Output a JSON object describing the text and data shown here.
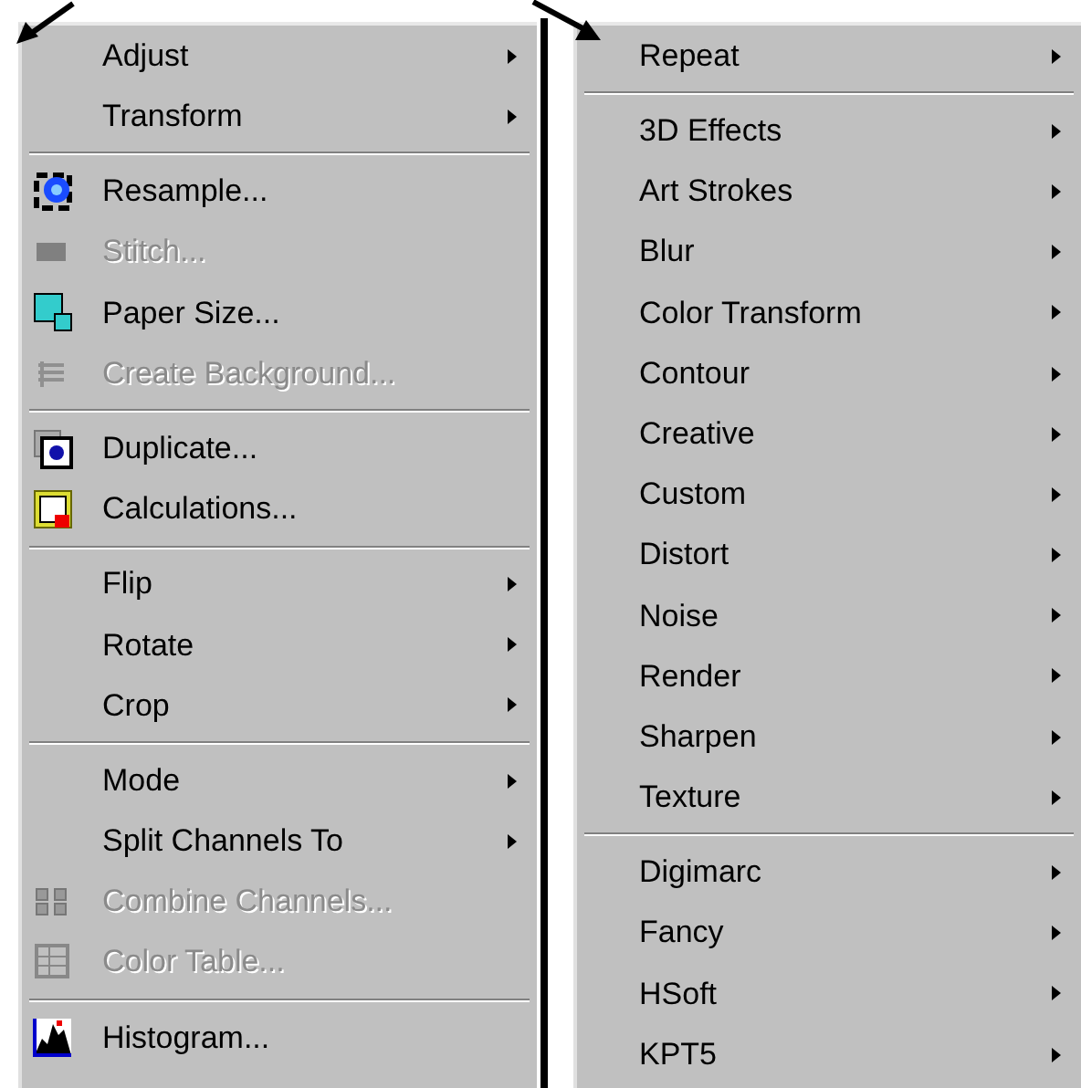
{
  "menus": [
    {
      "items": [
        {
          "kind": "submenu",
          "label": "Adjust",
          "disabled": false,
          "has_icon": false
        },
        {
          "kind": "submenu",
          "label": "Transform",
          "disabled": false,
          "has_icon": false
        },
        {
          "kind": "separator"
        },
        {
          "kind": "command",
          "label": "Resample...",
          "disabled": false,
          "has_icon": true
        },
        {
          "kind": "command",
          "label": "Stitch...",
          "disabled": true,
          "has_icon": true
        },
        {
          "kind": "command",
          "label": "Paper Size...",
          "disabled": false,
          "has_icon": true
        },
        {
          "kind": "command",
          "label": "Create Background...",
          "disabled": true,
          "has_icon": true
        },
        {
          "kind": "separator"
        },
        {
          "kind": "command",
          "label": "Duplicate...",
          "disabled": false,
          "has_icon": true
        },
        {
          "kind": "command",
          "label": "Calculations...",
          "disabled": false,
          "has_icon": true
        },
        {
          "kind": "separator"
        },
        {
          "kind": "submenu",
          "label": "Flip",
          "disabled": false,
          "has_icon": false
        },
        {
          "kind": "submenu",
          "label": "Rotate",
          "disabled": false,
          "has_icon": false
        },
        {
          "kind": "submenu",
          "label": "Crop",
          "disabled": false,
          "has_icon": false
        },
        {
          "kind": "separator"
        },
        {
          "kind": "submenu",
          "label": "Mode",
          "disabled": false,
          "has_icon": false
        },
        {
          "kind": "submenu",
          "label": "Split Channels To",
          "disabled": false,
          "has_icon": false
        },
        {
          "kind": "command",
          "label": "Combine Channels...",
          "disabled": true,
          "has_icon": true
        },
        {
          "kind": "command",
          "label": "Color Table...",
          "disabled": true,
          "has_icon": true
        },
        {
          "kind": "separator"
        },
        {
          "kind": "command",
          "label": "Histogram...",
          "disabled": false,
          "has_icon": true
        }
      ]
    },
    {
      "items": [
        {
          "kind": "submenu",
          "label": "Repeat",
          "disabled": false
        },
        {
          "kind": "separator"
        },
        {
          "kind": "submenu",
          "label": "3D Effects",
          "disabled": false
        },
        {
          "kind": "submenu",
          "label": "Art Strokes",
          "disabled": false
        },
        {
          "kind": "submenu",
          "label": "Blur",
          "disabled": false
        },
        {
          "kind": "submenu",
          "label": "Color Transform",
          "disabled": false
        },
        {
          "kind": "submenu",
          "label": "Contour",
          "disabled": false
        },
        {
          "kind": "submenu",
          "label": "Creative",
          "disabled": false
        },
        {
          "kind": "submenu",
          "label": "Custom",
          "disabled": false
        },
        {
          "kind": "submenu",
          "label": "Distort",
          "disabled": false
        },
        {
          "kind": "submenu",
          "label": "Noise",
          "disabled": false
        },
        {
          "kind": "submenu",
          "label": "Render",
          "disabled": false
        },
        {
          "kind": "submenu",
          "label": "Sharpen",
          "disabled": false
        },
        {
          "kind": "submenu",
          "label": "Texture",
          "disabled": false
        },
        {
          "kind": "separator"
        },
        {
          "kind": "submenu",
          "label": "Digimarc",
          "disabled": false
        },
        {
          "kind": "submenu",
          "label": "Fancy",
          "disabled": false
        },
        {
          "kind": "submenu",
          "label": "HSoft",
          "disabled": false
        },
        {
          "kind": "submenu",
          "label": "KPT5",
          "disabled": false
        }
      ]
    }
  ]
}
